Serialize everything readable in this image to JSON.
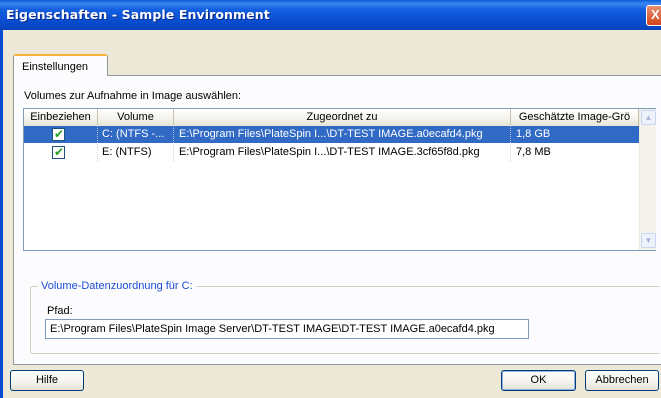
{
  "window": {
    "title": "Eigenschaften - Sample Environment",
    "close_glyph": "X"
  },
  "tabs": [
    {
      "label": "Einstellungen"
    }
  ],
  "volumes_section": {
    "label": "Volumes zur Aufnahme in Image auswählen:",
    "columns": [
      "Einbeziehen",
      "Volume",
      "Zugeordnet zu",
      "Geschätzte Image-Grö"
    ],
    "rows": [
      {
        "include": true,
        "volume": "C: (NTFS -...",
        "mapped_to": "E:\\Program Files\\PlateSpin I...\\DT-TEST IMAGE.a0ecafd4.pkg",
        "size": "1,8 GB",
        "selected": true
      },
      {
        "include": true,
        "volume": "E: (NTFS)",
        "mapped_to": "E:\\Program Files\\PlateSpin I...\\DT-TEST IMAGE.3cf65f8d.pkg",
        "size": "7,8 MB",
        "selected": false
      }
    ]
  },
  "mapping_group": {
    "title": "Volume-Datenzuordnung für C:",
    "path_label": "Pfad:",
    "path_value": "E:\\Program Files\\PlateSpin Image Server\\DT-TEST IMAGE\\DT-TEST IMAGE.a0ecafd4.pkg"
  },
  "buttons": {
    "help": "Hilfe",
    "ok": "OK",
    "cancel": "Abbrechen"
  },
  "icons": {
    "checkbox_checked": "checkmark-icon",
    "scroll_up": "scroll-up-icon",
    "scroll_down": "scroll-down-icon"
  },
  "colors": {
    "titlebar": "#0a4dd1",
    "selection": "#316ac5",
    "dialog_bg": "#ece9d8",
    "group_title": "#1b4dd4",
    "check_green": "#21a121"
  }
}
